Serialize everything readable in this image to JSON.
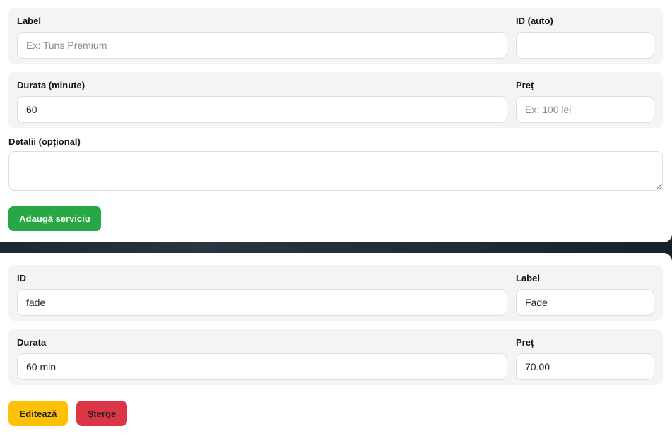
{
  "add_form": {
    "row1": {
      "label_field": {
        "label": "Label",
        "value": "",
        "placeholder": "Ex: Tuns Premium"
      },
      "id_field": {
        "label": "ID (auto)",
        "value": "",
        "placeholder": ""
      }
    },
    "row2": {
      "duration_field": {
        "label": "Durata (minute)",
        "value": "60",
        "placeholder": ""
      },
      "price_field": {
        "label": "Preț",
        "value": "",
        "placeholder": "Ex: 100 lei"
      }
    },
    "details_field": {
      "label": "Detalii (opțional)",
      "value": "",
      "placeholder": ""
    },
    "add_button_label": "Adaugă serviciu"
  },
  "service_item": {
    "row1": {
      "id_field": {
        "label": "ID",
        "value": "fade"
      },
      "label_field": {
        "label": "Label",
        "value": "Fade"
      }
    },
    "row2": {
      "duration_field": {
        "label": "Durata",
        "value": "60 min"
      },
      "price_field": {
        "label": "Preț",
        "value": "70.00"
      }
    },
    "edit_button_label": "Editează",
    "delete_button_label": "Șterge"
  },
  "colors": {
    "add_button": "#28a745",
    "edit_button": "#ffc107",
    "delete_button": "#dc3545",
    "row_background": "#f4f4f4"
  }
}
